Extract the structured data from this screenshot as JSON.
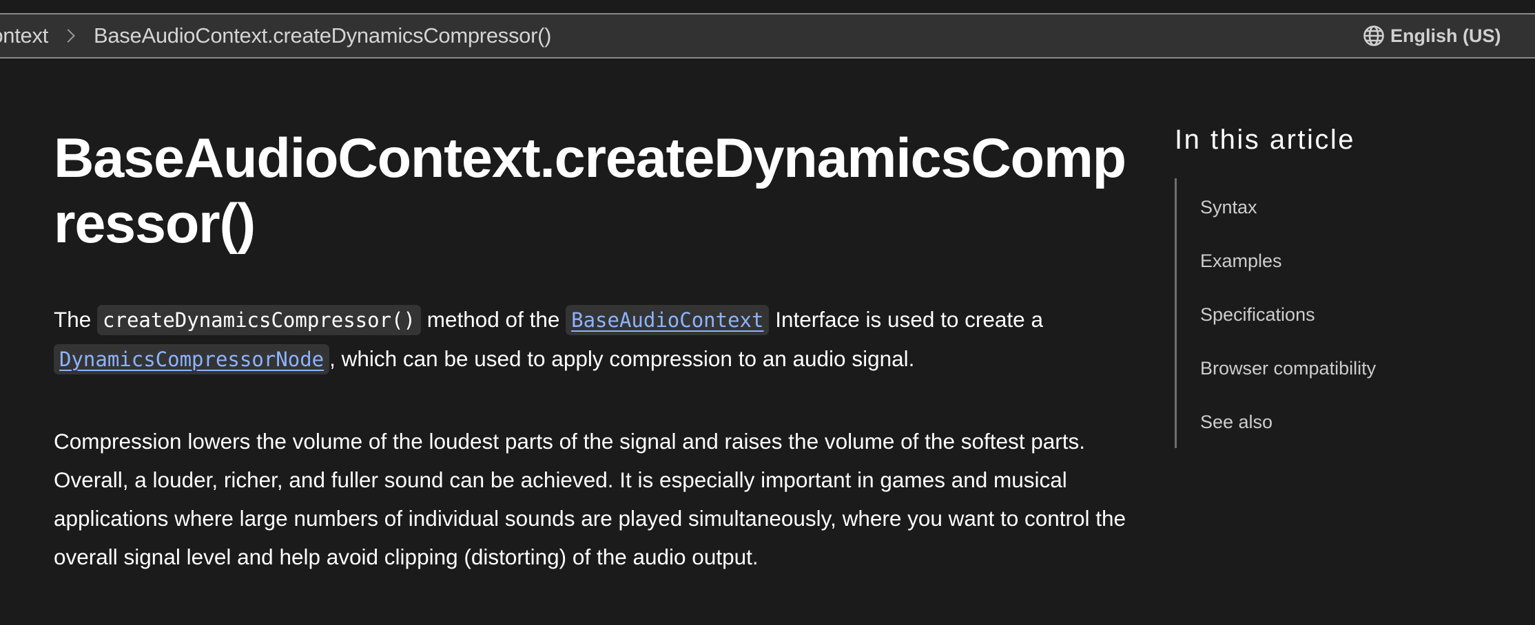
{
  "header": {
    "breadcrumbs": [
      {
        "label": "BaseAudioContext"
      },
      {
        "label": "BaseAudioContext.createDynamicsCompressor()"
      }
    ],
    "language": {
      "icon": "globe-icon",
      "label": "English (US)"
    }
  },
  "article": {
    "title": "BaseAudioContext.createDynamicsCompressor()",
    "intro": {
      "t1": "The ",
      "code1": "createDynamicsCompressor()",
      "t2": " method of the ",
      "link1": "BaseAudioContext",
      "t3": " Interface is used to create a ",
      "link2": "DynamicsCompressorNode",
      "t4": ", which can be used to apply compression to an audio signal."
    },
    "paragraph2": "Compression lowers the volume of the loudest parts of the signal and raises the volume of the softest parts. Overall, a louder, richer, and fuller sound can be achieved. It is especially important in games and musical applications where large numbers of individual sounds are played simultaneously, where you want to control the overall signal level and help avoid clipping (distorting) of the audio output."
  },
  "toc": {
    "heading": "In this article",
    "items": [
      {
        "label": "Syntax"
      },
      {
        "label": "Examples"
      },
      {
        "label": "Specifications"
      },
      {
        "label": "Browser compatibility"
      },
      {
        "label": "See also"
      }
    ]
  },
  "colors": {
    "background": "#1b1b1b",
    "topbar": "#323232",
    "link": "#8cb4ff",
    "code_bg": "#343434"
  }
}
